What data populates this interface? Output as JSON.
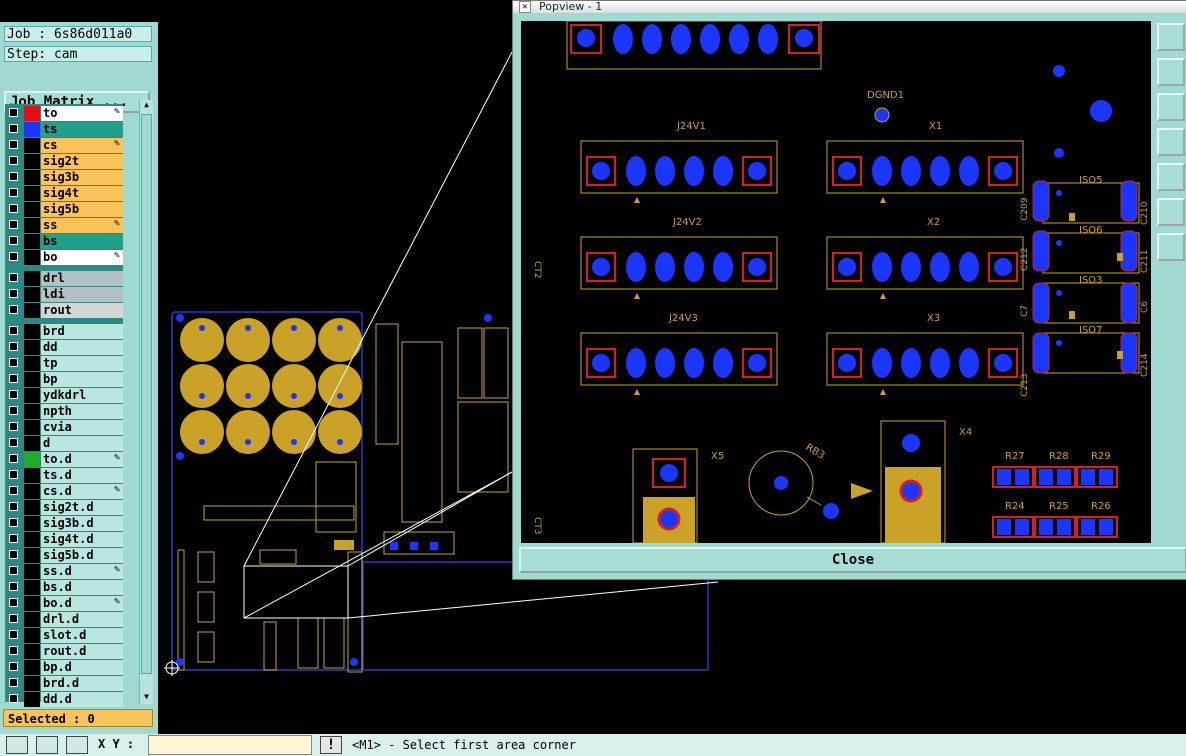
{
  "left_panel": {
    "job_label": "Job : 6s86d011a0",
    "step_label": "Step: cam",
    "job_matrix_button": "Job Matrix ...",
    "selected_label": "Selected : 0"
  },
  "layers": [
    {
      "name": "to",
      "color": "#ffffff",
      "marker": "red",
      "pen": true
    },
    {
      "name": "ts",
      "color": "#21a18c",
      "marker": "blue"
    },
    {
      "name": "cs",
      "color": "#f9c35b",
      "pen": true
    },
    {
      "name": "sig2t",
      "color": "#f9c35b"
    },
    {
      "name": "sig3b",
      "color": "#f9c35b"
    },
    {
      "name": "sig4t",
      "color": "#f9c35b"
    },
    {
      "name": "sig5b",
      "color": "#f9c35b"
    },
    {
      "name": "ss",
      "color": "#f9c35b",
      "pen": true
    },
    {
      "name": "bs",
      "color": "#21a18c"
    },
    {
      "name": "bo",
      "color": "#ffffff",
      "pen": true
    },
    {
      "name": "drl",
      "color": "#b4c0c2"
    },
    {
      "name": "ldi",
      "color": "#b4c0c2"
    },
    {
      "name": "rout",
      "color": "#d6d6d6"
    },
    {
      "name": "brd",
      "color": "#b8e7e0"
    },
    {
      "name": "dd",
      "color": "#b8e7e0"
    },
    {
      "name": "tp",
      "color": "#b8e7e0"
    },
    {
      "name": "bp",
      "color": "#b8e7e0"
    },
    {
      "name": "ydkdrl",
      "color": "#b8e7e0"
    },
    {
      "name": "npth",
      "color": "#b8e7e0"
    },
    {
      "name": "cvia",
      "color": "#b8e7e0"
    },
    {
      "name": "d",
      "color": "#b8e7e0"
    },
    {
      "name": "to.d",
      "color": "#b8e7e0",
      "marker": "green",
      "pen": true
    },
    {
      "name": "ts.d",
      "color": "#b8e7e0"
    },
    {
      "name": "cs.d",
      "color": "#b8e7e0",
      "pen": true
    },
    {
      "name": "sig2t.d",
      "color": "#b8e7e0"
    },
    {
      "name": "sig3b.d",
      "color": "#b8e7e0"
    },
    {
      "name": "sig4t.d",
      "color": "#b8e7e0"
    },
    {
      "name": "sig5b.d",
      "color": "#b8e7e0"
    },
    {
      "name": "ss.d",
      "color": "#b8e7e0",
      "pen": true
    },
    {
      "name": "bs.d",
      "color": "#b8e7e0"
    },
    {
      "name": "bo.d",
      "color": "#b8e7e0",
      "pen": true
    },
    {
      "name": "drl.d",
      "color": "#b8e7e0"
    },
    {
      "name": "slot.d",
      "color": "#b8e7e0"
    },
    {
      "name": "rout.d",
      "color": "#b8e7e0"
    },
    {
      "name": "bp.d",
      "color": "#b8e7e0"
    },
    {
      "name": "brd.d",
      "color": "#b8e7e0"
    },
    {
      "name": "dd.d",
      "color": "#b8e7e0"
    }
  ],
  "popview": {
    "title": "Popview - 1",
    "close_label": "Close",
    "labels": {
      "dgnd1": "DGND1",
      "j24v1": "J24V1",
      "x1": "X1",
      "j24v2": "J24V2",
      "x2": "X2",
      "j24v3": "J24V3",
      "x3": "X3",
      "x4": "X4",
      "x5": "X5",
      "rb3": "RB3",
      "r27": "R27",
      "r28": "R28",
      "r29": "R29",
      "r24": "R24",
      "r25": "R25",
      "r26": "R26",
      "iso5": "ISO5",
      "iso6": "ISO6",
      "iso3": "ISO3",
      "iso7": "ISO7",
      "c209": "C209",
      "c210": "C210",
      "c212": "C212",
      "c211": "C211",
      "c7": "C7",
      "c6": "C6",
      "c213": "C213",
      "c214": "C214",
      "ct2": "CT2",
      "ct3": "CT3"
    }
  },
  "bottom_bar": {
    "xy_label": "X Y :",
    "status": "<M1> - Select first area corner"
  },
  "colors": {
    "panel_bg": "#9fd9d0",
    "pcb_bg": "#000000",
    "copper": "#c9a227",
    "pad_blue": "#1b36ff",
    "pad_red": "#d42020",
    "outline": "#2040c8"
  }
}
